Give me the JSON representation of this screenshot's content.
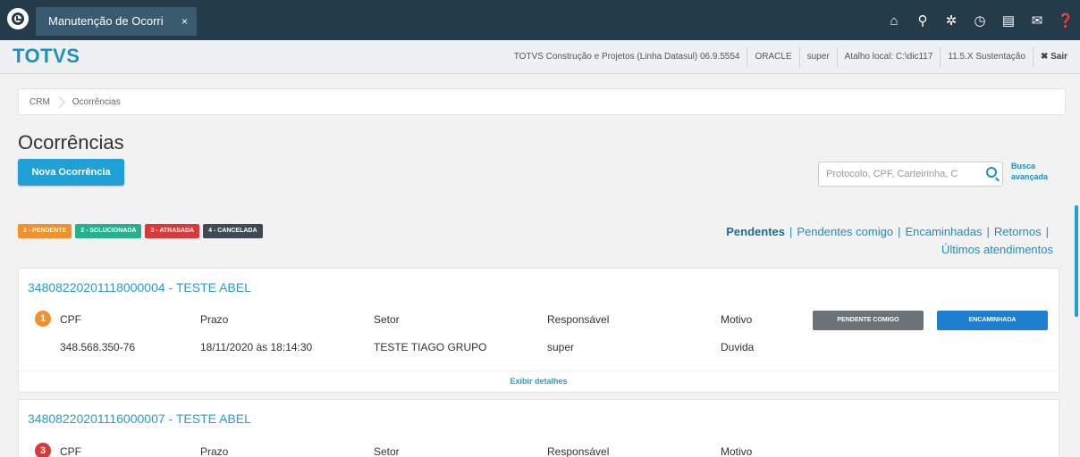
{
  "tab": {
    "title": "Manutenção de Ocorri",
    "close": "×"
  },
  "topbar": {
    "icons": [
      "home-icon",
      "org-chart-icon",
      "gear-icon",
      "clock-icon",
      "document-icon",
      "mail-icon",
      "help-icon"
    ],
    "glyphs": [
      "⌂",
      "⚲",
      "✲",
      "◷",
      "▤",
      "✉",
      "❓"
    ]
  },
  "brand": {
    "name": "TOTVS"
  },
  "info": {
    "product": "TOTVS Construção e Projetos (Linha Datasul) 06.9.5554",
    "db": "ORACLE",
    "user": "super",
    "shortcut": "Atalho local: C:\\dic117",
    "version": "11.5.X Sustentação",
    "logout": "✖ Sair"
  },
  "breadcrumb": {
    "items": [
      "CRM",
      "Ocorrências"
    ]
  },
  "page": {
    "title": "Ocorrências",
    "new_button": "Nova Ocorrência"
  },
  "search": {
    "placeholder": "Protocolo, CPF, Carteirinha, C",
    "advanced": "Busca avançada"
  },
  "legend": [
    {
      "label": "1 - PENDENTE",
      "color": "#f0912c"
    },
    {
      "label": "2 - SOLUCIONADA",
      "color": "#26b08c"
    },
    {
      "label": "3 - ATRASADA",
      "color": "#d9393b"
    },
    {
      "label": "4 - CANCELADA",
      "color": "#3f4a55"
    }
  ],
  "filters": {
    "items": [
      "Pendentes",
      "Pendentes comigo",
      "Encaminhadas",
      "Retornos",
      "Últimos atendimentos"
    ],
    "separator": "|"
  },
  "columns": {
    "cpf": "CPF",
    "prazo": "Prazo",
    "setor": "Setor",
    "responsavel": "Responsável",
    "motivo": "Motivo"
  },
  "occurrences": [
    {
      "title": "34808220201118000004 - TESTE ABEL",
      "status": "1",
      "status_color": "#f0912c",
      "cpf": "348.568.350-76",
      "prazo": "18/11/2020 às 18:14:30",
      "setor": "TESTE TIAGO GRUPO",
      "responsavel": "super",
      "motivo": "Duvida",
      "tag1": "PENDENTE COMIGO",
      "tag2": "ENCAMINHADA",
      "details": "Exibir detalhes"
    },
    {
      "title": "34808220201116000007 - TESTE ABEL",
      "status": "3",
      "status_color": "#d9393b"
    }
  ]
}
